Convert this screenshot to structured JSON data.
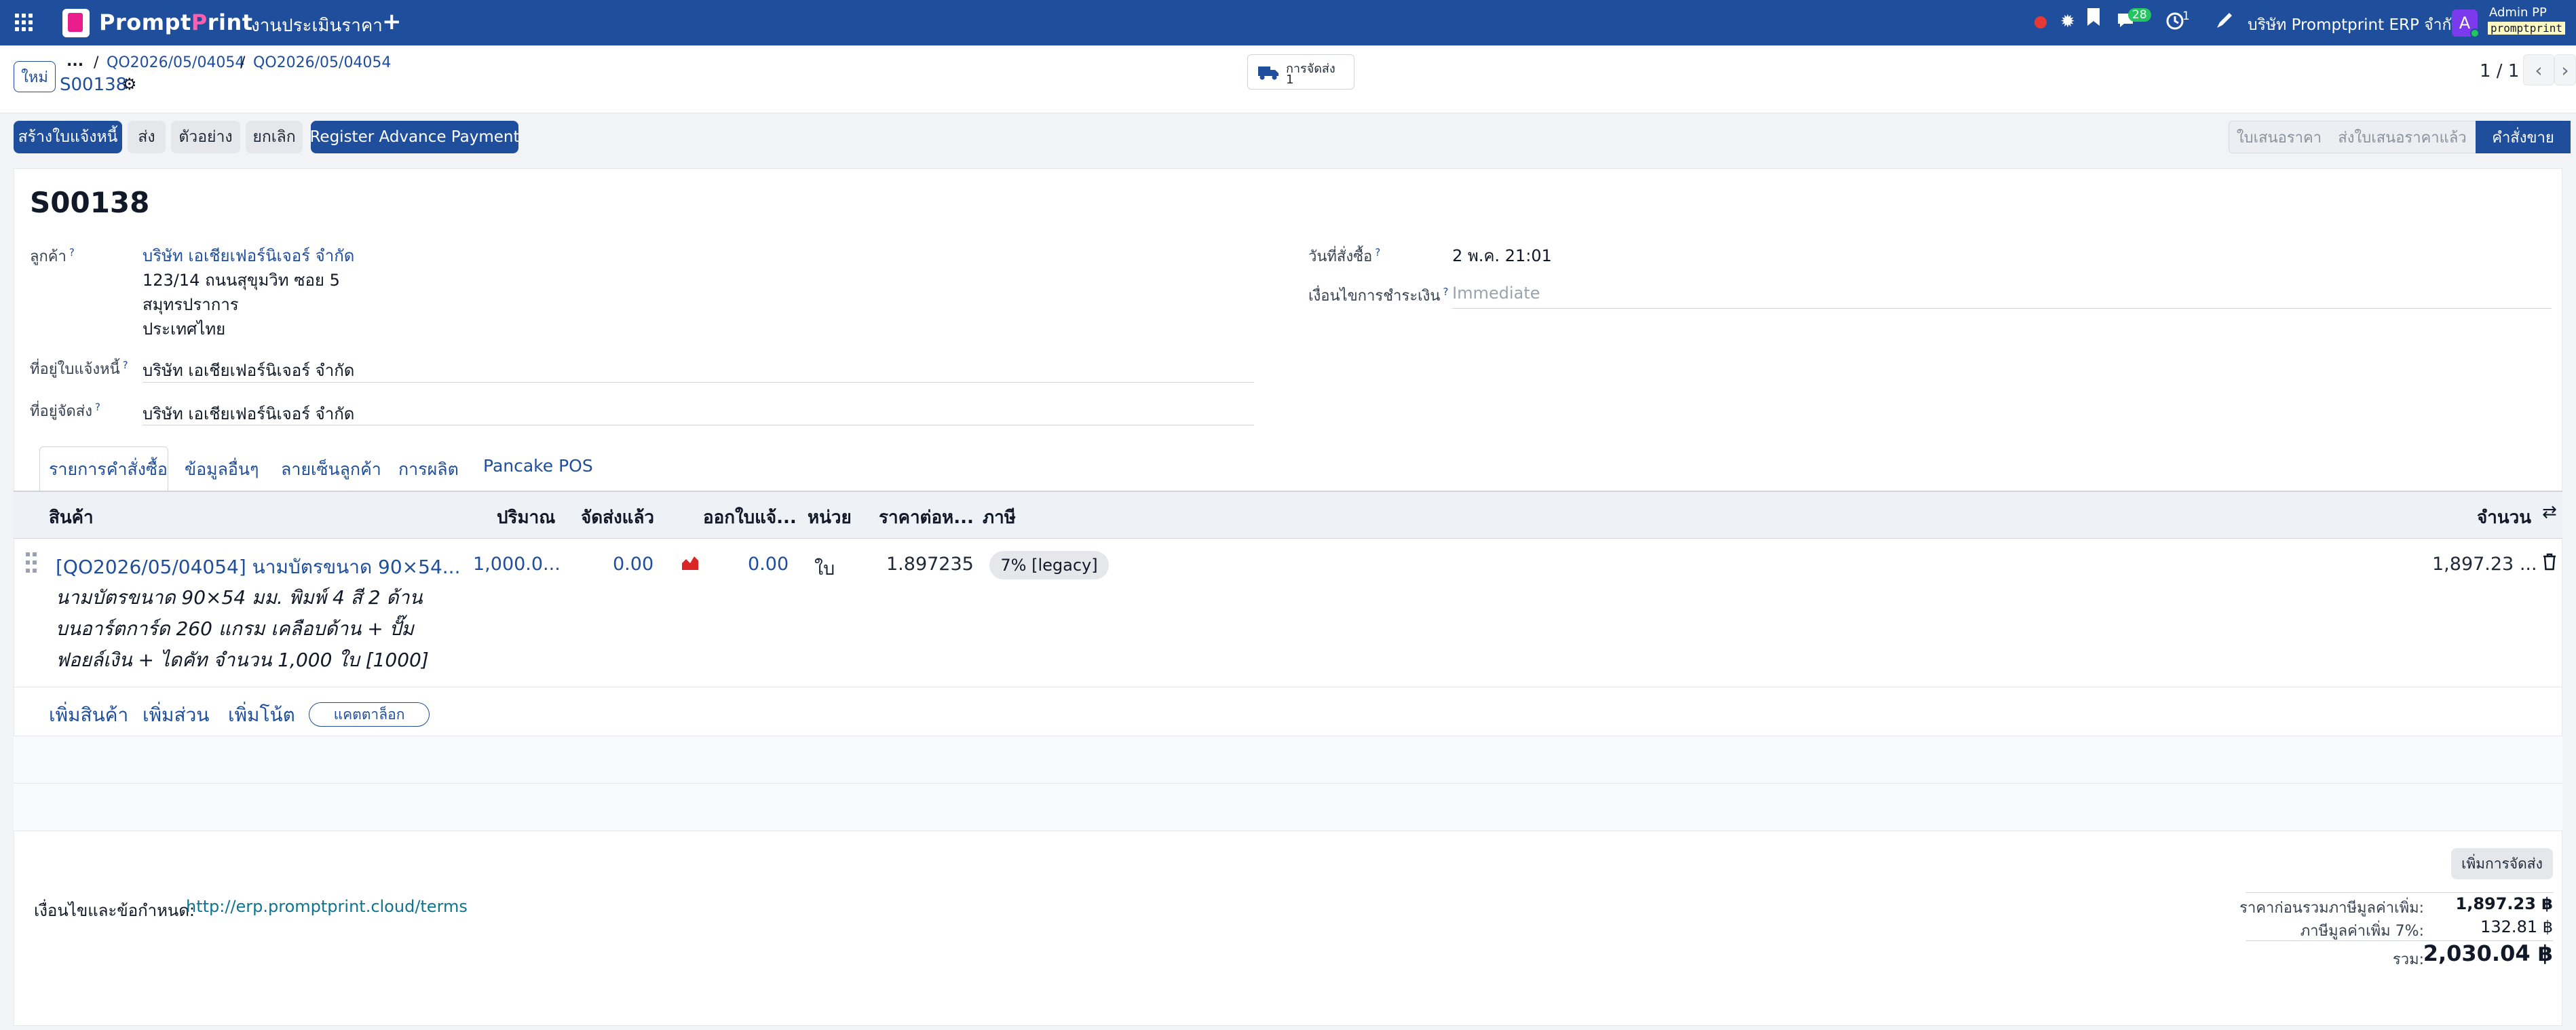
{
  "topbar": {
    "brand_a": "Prompt",
    "brand_b": "P",
    "brand_c": "rint",
    "menu_title": "งานประเมินราคา",
    "plus": "+",
    "chat_count": "28",
    "activity_count": "1",
    "company": "บริษัท Promptprint ERP จำกัด",
    "avatar_letter": "A",
    "user_name": "Admin PP",
    "user_db": "promptprint"
  },
  "breadcrumb": {
    "new_label": "ใหม่",
    "ellipsis": "...",
    "sep": "/",
    "item1": "QO2026/05/04054",
    "item2": "QO2026/05/04054",
    "record": "S00138"
  },
  "delivery_smart": {
    "label": "การจัดส่ง",
    "count": "1"
  },
  "pager": {
    "text": "1 / 1"
  },
  "actions": {
    "create_invoice": "สร้างใบแจ้งหนี้",
    "send": "ส่ง",
    "preview": "ตัวอย่าง",
    "cancel": "ยกเลิก",
    "advance": "Register Advance Payment"
  },
  "stages": [
    "ใบเสนอราคา",
    "ส่งใบเสนอราคาแล้ว",
    "คำสั่งขาย"
  ],
  "form": {
    "title": "S00138",
    "customer_label": "ลูกค้า",
    "customer_name": "บริษัท เอเชียเฟอร์นิเจอร์ จำกัด",
    "addr1": "123/14 ถนนสุขุมวิท ซอย 5",
    "addr2": "สมุทรปราการ",
    "addr3": "ประเทศไทย",
    "invoice_addr_label": "ที่อยู่ใบแจ้งหนี้",
    "invoice_addr": "บริษัท เอเชียเฟอร์นิเจอร์ จำกัด",
    "delivery_addr_label": "ที่อยู่จัดส่ง",
    "delivery_addr": "บริษัท เอเชียเฟอร์นิเจอร์ จำกัด",
    "order_date_label": "วันที่สั่งซื้อ",
    "order_date": "2 พ.ค. 21:01",
    "payment_terms_label": "เงื่อนไขการชำระเงิน",
    "payment_terms_placeholder": "Immediate",
    "help": "?"
  },
  "tabs": [
    "รายการคำสั่งซื้อ",
    "ข้อมูลอื่นๆ",
    "ลายเซ็นลูกค้า",
    "การผลิต",
    "Pancake POS"
  ],
  "table": {
    "headers": {
      "product": "สินค้า",
      "qty": "ปริมาณ",
      "delivered": "จัดส่งแล้ว",
      "invoiced": "ออกใบแจ้...",
      "uom": "หน่วย",
      "price": "ราคาต่อห...",
      "tax": "ภาษี",
      "amount": "จำนวน"
    },
    "row": {
      "product": "[QO2026/05/04054] นามบัตรขนาด 90×54...",
      "desc1": "นามบัตรขนาด 90×54 มม. พิมพ์ 4 สี 2 ด้าน",
      "desc2": "บนอาร์ตการ์ด 260 แกรม เคลือบด้าน + ปั๊ม",
      "desc3": "ฟอยล์เงิน + ไดคัท จำนวน 1,000 ใบ [1000]",
      "qty": "1,000.0...",
      "delivered": "0.00",
      "invoiced": "0.00",
      "uom": "ใบ",
      "price": "1.897235",
      "tax": "7% [legacy]",
      "amount": "1,897.23 ..."
    },
    "add_product": "เพิ่มสินค้า",
    "add_section": "เพิ่มส่วน",
    "add_note": "เพิ่มโน้ต",
    "catalog": "แคตตาล็อก"
  },
  "footer": {
    "add_shipping": "เพิ่มการจัดส่ง",
    "terms_label": "เงื่อนไขและข้อกำหนด:",
    "terms_link": "http://erp.promptprint.cloud/terms",
    "untaxed_label": "ราคาก่อนรวมภาษีมูลค่าเพิ่ม:",
    "untaxed": "1,897.23 ฿",
    "vat_label": "ภาษีมูลค่าเพิ่ม 7%:",
    "vat": "132.81 ฿",
    "total_label": "รวม:",
    "total": "2,030.04 ฿"
  },
  "colors": {
    "primary": "#1f4e9c",
    "brand_pink": "#e91e8c",
    "badge_green": "#22c55e",
    "bug_red": "#e53935"
  }
}
